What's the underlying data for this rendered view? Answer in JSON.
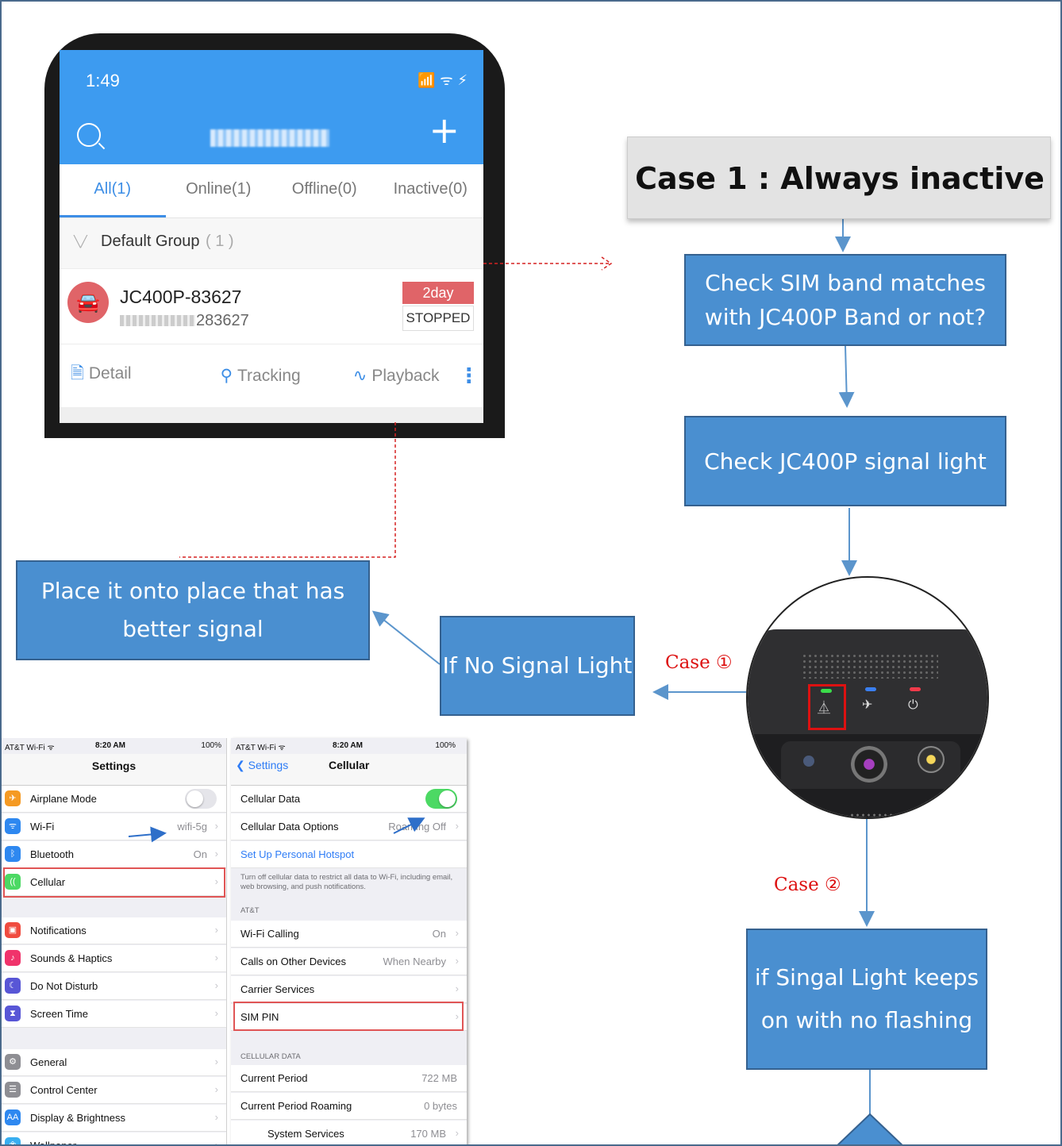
{
  "phone_app": {
    "time": "1:49",
    "status_icons": "📶 ᯤ ⚡",
    "search_icon": "search-icon",
    "add_icon": "plus-icon",
    "tabs": [
      "All(1)",
      "Online(1)",
      "Offline(0)",
      "Inactive(0)"
    ],
    "group_name": "Default Group",
    "group_count": "( 1 )",
    "device_name": "JC400P-83627",
    "device_imei_suffix": "283627",
    "badge_days": "2day",
    "badge_status": "STOPPED",
    "actions": {
      "detail": "Detail",
      "tracking": "Tracking",
      "playback": "Playback"
    },
    "colors": {
      "header": "#3d9bf0",
      "accent": "#3d8ee6",
      "alert": "#e06468"
    }
  },
  "flow": {
    "title": "Case 1 : Always inactive",
    "step1": "Check SIM band matches with JC400P Band or not?",
    "step2": "Check JC400P signal light",
    "no_signal": "If No Signal Light",
    "better_signal": "Place it onto place that has better signal",
    "signal_on": "if Singal Light keeps on with no flashing",
    "case1_label": "Case ①",
    "case2_label": "Case ②",
    "colors": {
      "box": "#4a8fd0",
      "arrow": "#5b95cc",
      "label": "#dd1111",
      "dashed": "#d62222"
    }
  },
  "ios_settings": {
    "status_left": "AT&T Wi-Fi ᯤ",
    "status_time": "8:20 AM",
    "status_right": "100%",
    "title": "Settings",
    "rows": [
      {
        "label": "Airplane Mode",
        "value": "",
        "icon_color": "#f59a23",
        "icon": "✈"
      },
      {
        "label": "Wi-Fi",
        "value": "wifi-5g",
        "icon_color": "#2e88f0",
        "icon": "ᯤ"
      },
      {
        "label": "Bluetooth",
        "value": "On",
        "icon_color": "#2e88f0",
        "icon": "ᛒ"
      },
      {
        "label": "Cellular",
        "value": "",
        "icon_color": "#4cd964",
        "icon": "((·))"
      },
      {
        "label": "Notifications",
        "value": "",
        "icon_color": "#f04b3f",
        "icon": "▣"
      },
      {
        "label": "Sounds & Haptics",
        "value": "",
        "icon_color": "#f0336b",
        "icon": "♪"
      },
      {
        "label": "Do Not Disturb",
        "value": "",
        "icon_color": "#5856d6",
        "icon": "☾"
      },
      {
        "label": "Screen Time",
        "value": "",
        "icon_color": "#5856d6",
        "icon": "⧗"
      },
      {
        "label": "General",
        "value": "",
        "icon_color": "#8e8e93",
        "icon": "⚙"
      },
      {
        "label": "Control Center",
        "value": "",
        "icon_color": "#8e8e93",
        "icon": "☰"
      },
      {
        "label": "Display & Brightness",
        "value": "",
        "icon_color": "#2e88f0",
        "icon": "AA"
      },
      {
        "label": "Wallpaper",
        "value": "",
        "icon_color": "#38aef0",
        "icon": "❀"
      }
    ]
  },
  "ios_cellular": {
    "status_left": "AT&T Wi-Fi ᯤ",
    "status_time": "8:20 AM",
    "status_right": "100%",
    "back": "Settings",
    "title": "Cellular",
    "cellular_data": "Cellular Data",
    "data_options": "Cellular Data Options",
    "data_options_value": "Roaming Off",
    "hotspot": "Set Up Personal Hotspot",
    "footer_note": "Turn off cellular data to restrict all data to Wi-Fi, including email, web browsing, and push notifications.",
    "carrier_head": "AT&T",
    "wifi_calling": "Wi-Fi Calling",
    "wifi_calling_value": "On",
    "other_devices": "Calls on Other Devices",
    "other_devices_value": "When Nearby",
    "carrier_services": "Carrier Services",
    "sim_pin": "SIM PIN",
    "data_head": "CELLULAR DATA",
    "current_period": "Current Period",
    "current_period_value": "722 MB",
    "roaming": "Current Period Roaming",
    "roaming_value": "0 bytes",
    "system_services": "System Services",
    "system_services_value": "170 MB"
  }
}
